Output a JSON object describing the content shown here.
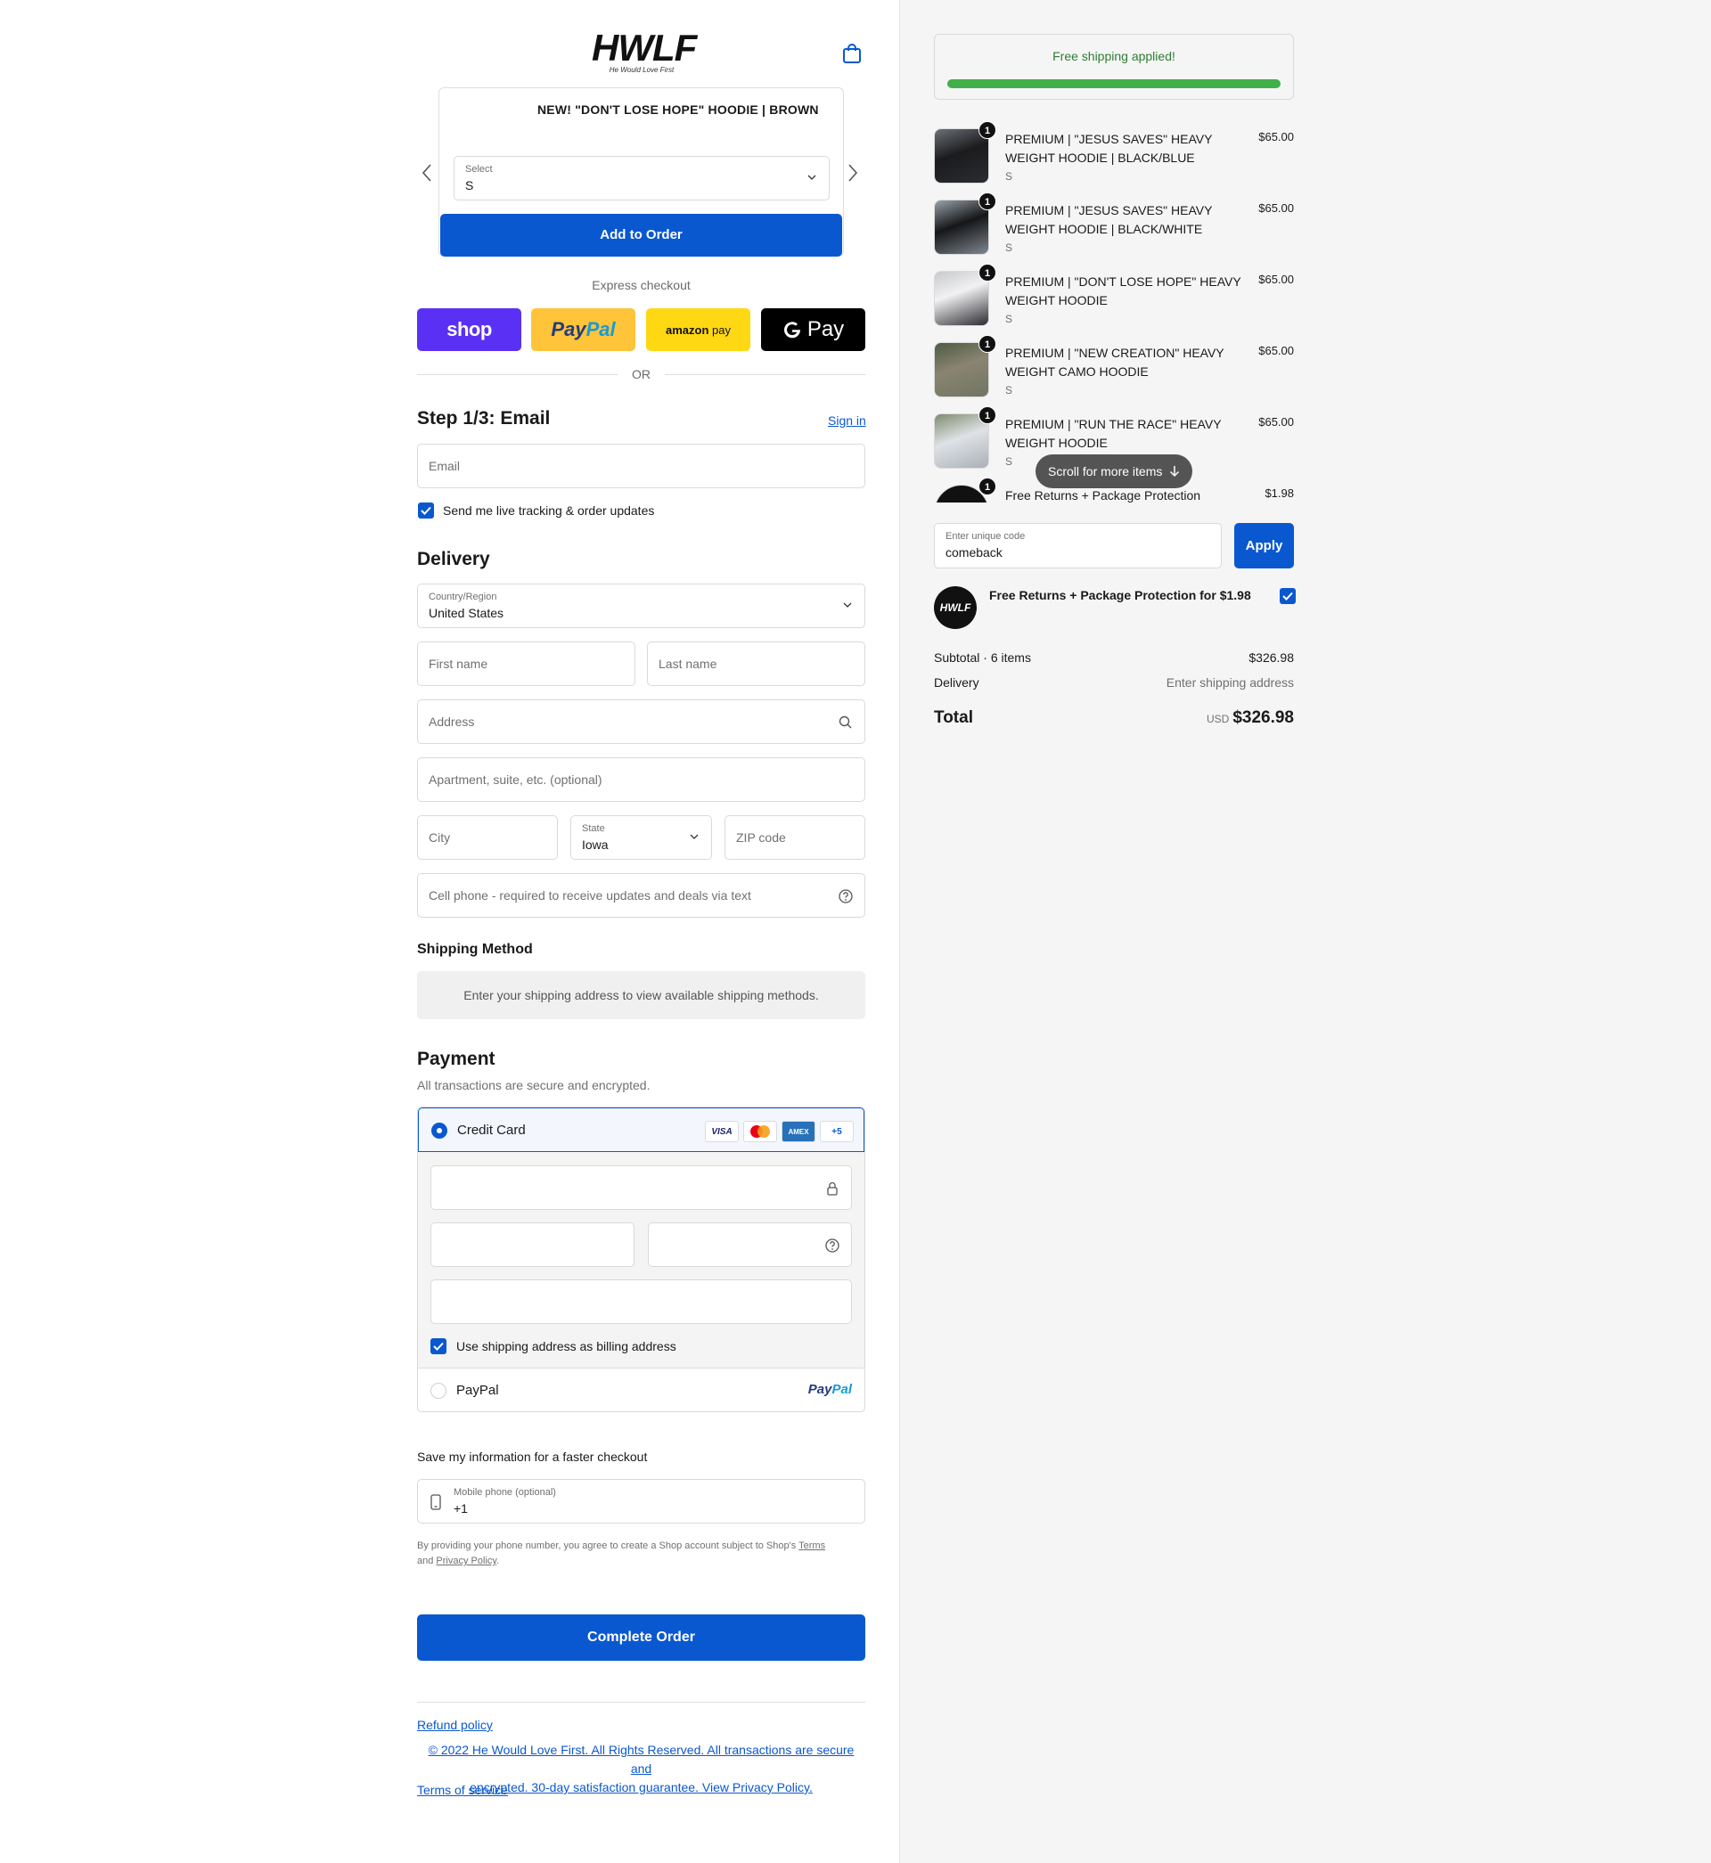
{
  "header": {
    "logo_text": "HWLF",
    "logo_tagline": "He Would Love First"
  },
  "upsell": {
    "title": "NEW! \"DON'T LOSE HOPE\" HOODIE | BROWN",
    "select_label": "Select",
    "select_value": "S",
    "button_label": "Add to Order"
  },
  "express": {
    "label": "Express checkout",
    "buttons": [
      "shop",
      "PayPal",
      "amazon pay",
      "G Pay"
    ],
    "or_text": "OR"
  },
  "email_section": {
    "title": "Step 1/3: Email",
    "sign_in": "Sign in",
    "email_placeholder": "Email",
    "tracking_label": "Send me live tracking & order updates"
  },
  "delivery": {
    "title": "Delivery",
    "country_label": "Country/Region",
    "country_value": "United States",
    "first_name_placeholder": "First name",
    "last_name_placeholder": "Last name",
    "address_placeholder": "Address",
    "apartment_placeholder": "Apartment, suite, etc. (optional)",
    "city_placeholder": "City",
    "state_label": "State",
    "state_value": "Iowa",
    "zip_placeholder": "ZIP code",
    "phone_placeholder": "Cell phone - required to receive updates and deals via text"
  },
  "shipping_method": {
    "title": "Shipping Method",
    "message": "Enter your shipping address to view available shipping methods."
  },
  "payment": {
    "title": "Payment",
    "subtitle": "All transactions are secure and encrypted.",
    "credit_card_label": "Credit Card",
    "card_badges": [
      "VISA",
      "AMEX",
      "+5"
    ],
    "billing_label": "Use shipping address as billing address",
    "paypal_label": "PayPal",
    "paypal_logo": "PayPal"
  },
  "save_info": {
    "title": "Save my information for a faster checkout",
    "mobile_label": "Mobile phone (optional)",
    "mobile_value": "+1",
    "legal_prefix": "By providing your phone number, you agree to create a Shop account subject to Shop's",
    "terms_link": "Terms",
    "legal_and": "and",
    "privacy_link": "Privacy Policy",
    "legal_end": "."
  },
  "complete_button": "Complete Order",
  "footer": {
    "refund": "Refund policy",
    "copyright_line1": "© 2022 He Would Love First. All Rights Reserved. All transactions are secure and",
    "copyright_line2": "encrypted. 30-day satisfaction guarantee. View Privacy Policy.",
    "terms": "Terms of service"
  },
  "summary": {
    "free_shipping": "Free shipping applied!",
    "free_shipping_progress": 1.0,
    "items": [
      {
        "qty": "1",
        "name_line1": "PREMIUM | \"JESUS SAVES\" HEAVY",
        "name_line2": "WEIGHT HOODIE | BLACK/BLUE",
        "variant": "S",
        "price": "$65.00"
      },
      {
        "qty": "1",
        "name_line1": "PREMIUM | \"JESUS SAVES\" HEAVY",
        "name_line2": "WEIGHT HOODIE | BLACK/WHITE",
        "variant": "S",
        "price": "$65.00"
      },
      {
        "qty": "1",
        "name_line1": "PREMIUM | \"DON'T LOSE HOPE\" HEAVY",
        "name_line2": "WEIGHT HOODIE",
        "variant": "S",
        "price": "$65.00"
      },
      {
        "qty": "1",
        "name_line1": "PREMIUM | \"NEW CREATION\" HEAVY",
        "name_line2": "WEIGHT CAMO HOODIE",
        "variant": "S",
        "price": "$65.00"
      },
      {
        "qty": "1",
        "name_line1": "PREMIUM | \"RUN THE RACE\" HEAVY",
        "name_line2": "WEIGHT HOODIE",
        "variant": "S",
        "price": "$65.00"
      },
      {
        "qty": "1",
        "name_line1": "Free Returns + Package Protection",
        "name_line2": "",
        "variant": "",
        "price": "$1.98"
      }
    ],
    "scroll_hint": "Scroll for more items",
    "code_label": "Enter unique code",
    "code_value": "comeback",
    "apply": "Apply",
    "protection_logo": "HWLF",
    "protection_text": "Free Returns + Package Protection for $1.98",
    "subtotal_label": "Subtotal · 6 items",
    "subtotal_value": "$326.98",
    "delivery_label": "Delivery",
    "delivery_value": "Enter shipping address",
    "total_label": "Total",
    "currency": "USD",
    "total_value": "$326.98"
  },
  "colors": {
    "accent": "#0a58d0",
    "success": "#41b04a"
  }
}
